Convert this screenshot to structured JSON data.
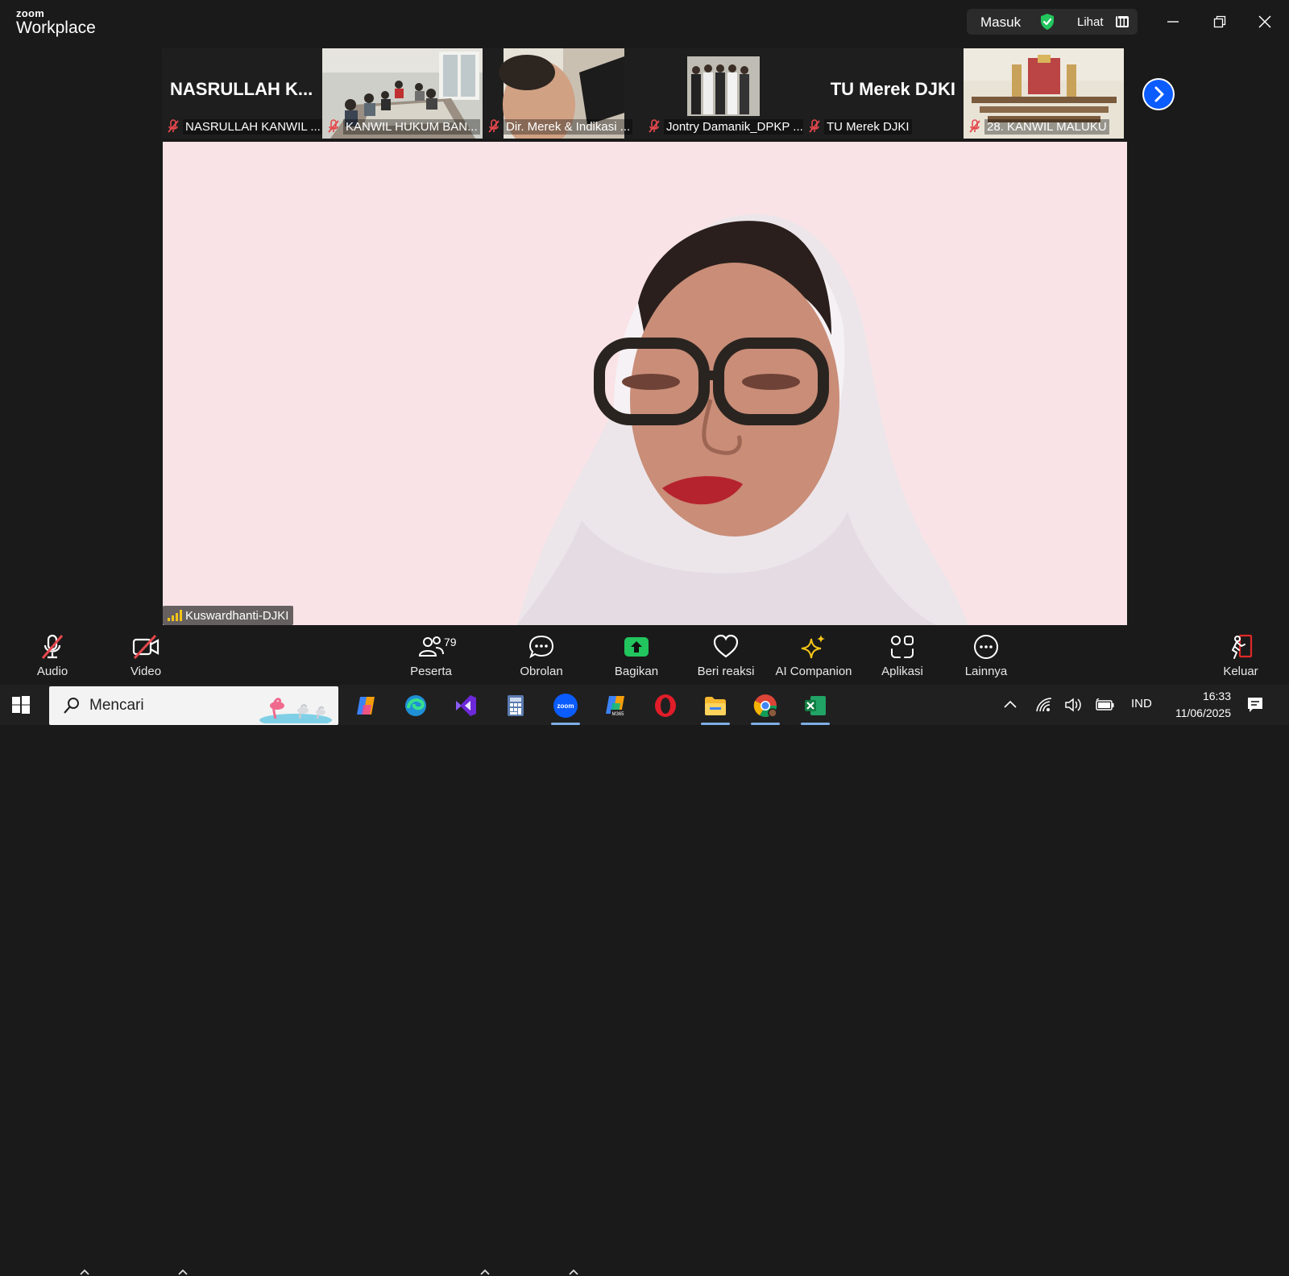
{
  "window": {
    "logo_top": "zoom",
    "logo_bottom": "Workplace",
    "signin_label": "Masuk",
    "view_label": "Lihat"
  },
  "thumbnails": [
    {
      "display_name": "NASRULLAH  K...",
      "label": "NASRULLAH KANWIL ...",
      "muted": true,
      "has_video": false
    },
    {
      "display_name": "",
      "label": "KANWIL HUKUM BAN...",
      "muted": true,
      "has_video": true
    },
    {
      "display_name": "",
      "label": "Dir. Merek & Indikasi ...",
      "muted": true,
      "has_video": true
    },
    {
      "display_name": "",
      "label": "Jontry Damanik_DPKP ...",
      "muted": true,
      "has_video": true
    },
    {
      "display_name": "TU Merek DJKI",
      "label": "TU Merek DJKI",
      "muted": true,
      "has_video": false
    },
    {
      "display_name": "",
      "label": "28. KANWIL MALUKU",
      "muted": true,
      "has_video": true
    }
  ],
  "active_speaker": {
    "name": "Kuswardhanti-DJKI"
  },
  "toolbar": {
    "audio": "Audio",
    "video": "Video",
    "participants": "Peserta",
    "participants_count": "79",
    "chat": "Obrolan",
    "share": "Bagikan",
    "react": "Beri reaksi",
    "ai": "AI Companion",
    "apps": "Aplikasi",
    "more": "Lainnya",
    "leave": "Keluar"
  },
  "taskbar": {
    "search_placeholder": "Mencari",
    "lang": "IND",
    "time": "16:33",
    "date": "11/06/2025"
  },
  "colors": {
    "accent_blue": "#0b5cff",
    "share_green": "#22c55e",
    "mute_red": "#e5484d",
    "leave_red": "#e02828"
  }
}
